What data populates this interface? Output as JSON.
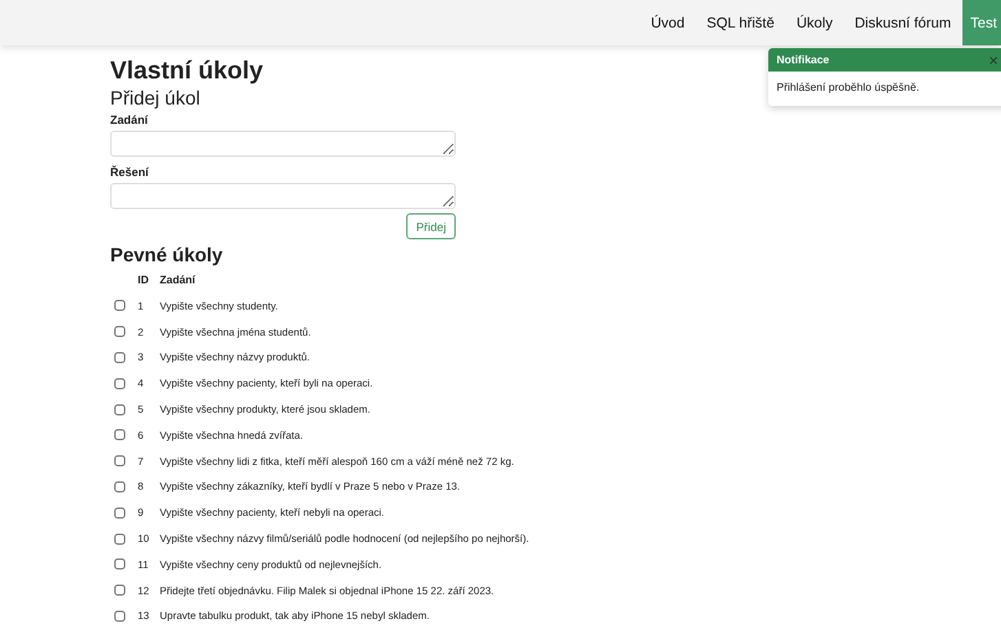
{
  "nav": {
    "items": [
      {
        "label": "Úvod",
        "selected": false
      },
      {
        "label": "SQL hřiště",
        "selected": false
      },
      {
        "label": "Úkoly",
        "selected": false
      },
      {
        "label": "Diskusní fórum",
        "selected": false
      },
      {
        "label": "Test",
        "selected": true
      }
    ]
  },
  "toast": {
    "title": "Notifikace",
    "close": "×",
    "message": "Přihlášení proběhlo úspěšně."
  },
  "title": "Vlastní úkoly",
  "form": {
    "heading": "Přidej úkol",
    "fields": [
      {
        "label": "Zadání"
      },
      {
        "label": "Řešení"
      }
    ],
    "button": "Přidej"
  },
  "fixed": {
    "heading": "Pevné úkoly",
    "columns": [
      "ID",
      "Zadání"
    ],
    "rows": [
      {
        "checked": false,
        "id": "1",
        "text": "Vypište všechny studenty."
      },
      {
        "checked": false,
        "id": "2",
        "text": "Vypište všechna jména studentů."
      },
      {
        "checked": false,
        "id": "3",
        "text": "Vypište všechny názvy produktů."
      },
      {
        "checked": false,
        "id": "4",
        "text": "Vypište všechny pacienty, kteří byli na operaci."
      },
      {
        "checked": false,
        "id": "5",
        "text": "Vypište všechny produkty, které jsou skladem."
      },
      {
        "checked": false,
        "id": "6",
        "text": "Vypište všechna hnedá zvířata."
      },
      {
        "checked": false,
        "id": "7",
        "text": "Vypište všechny lidi z fitka, kteří měří alespoň 160 cm a váží méně než 72 kg."
      },
      {
        "checked": false,
        "id": "8",
        "text": "Vypište všechny zákazníky, kteří bydlí v Praze 5 nebo v Praze 13."
      },
      {
        "checked": false,
        "id": "9",
        "text": "Vypište všechny pacienty, kteří nebyli na operaci."
      },
      {
        "checked": false,
        "id": "10",
        "text": "Vypište všechny názvy filmů/seriálů podle hodnocení (od nejlepšího po nejhorší)."
      },
      {
        "checked": false,
        "id": "11",
        "text": "Vypište všechny ceny produktů od nejlevnejších."
      },
      {
        "checked": false,
        "id": "12",
        "text": "Přidejte třetí objednávku. Filip Malek si objednal iPhone 15 22. září 2023."
      },
      {
        "checked": false,
        "id": "13",
        "text": "Upravte tabulku produkt, tak aby iPhone 15 nebyl skladem."
      }
    ]
  }
}
